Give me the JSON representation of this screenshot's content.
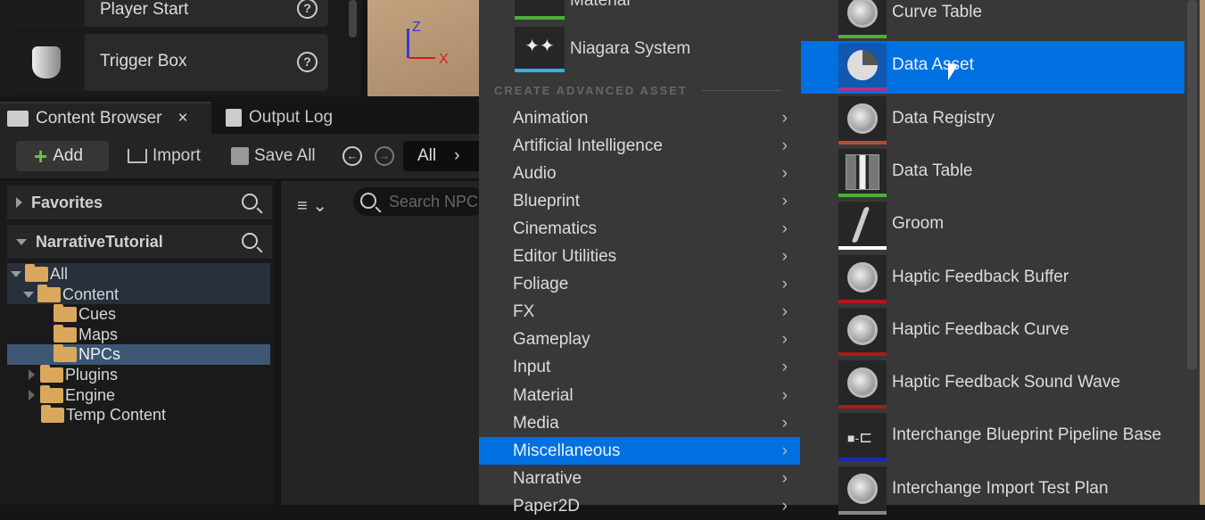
{
  "place_actors": [
    {
      "label": "Player Start"
    },
    {
      "label": "Trigger Box"
    }
  ],
  "viewport": {
    "axis_z": "Z",
    "axis_x": "X"
  },
  "tabs": [
    {
      "label": "Content Browser",
      "close": "×"
    },
    {
      "label": "Output Log"
    }
  ],
  "toolbar": {
    "add": "Add",
    "import": "Import",
    "save_all": "Save All",
    "path": "All"
  },
  "sources": {
    "favorites": "Favorites",
    "project": "NarrativeTutorial"
  },
  "tree": [
    {
      "label": "All"
    },
    {
      "label": "Content"
    },
    {
      "label": "Cues"
    },
    {
      "label": "Maps"
    },
    {
      "label": "NPCs"
    },
    {
      "label": "Plugins"
    },
    {
      "label": "Engine"
    },
    {
      "label": "Temp Content"
    }
  ],
  "search": {
    "placeholder": "Search NPCs"
  },
  "menu": {
    "basic": [
      {
        "label": "Material"
      },
      {
        "label": "Niagara System"
      }
    ],
    "section": "CREATE ADVANCED ASSET",
    "categories": [
      {
        "label": "Animation"
      },
      {
        "label": "Artificial Intelligence"
      },
      {
        "label": "Audio"
      },
      {
        "label": "Blueprint"
      },
      {
        "label": "Cinematics"
      },
      {
        "label": "Editor Utilities"
      },
      {
        "label": "Foliage"
      },
      {
        "label": "FX"
      },
      {
        "label": "Gameplay"
      },
      {
        "label": "Input"
      },
      {
        "label": "Material"
      },
      {
        "label": "Media"
      },
      {
        "label": "Miscellaneous",
        "selected": true
      },
      {
        "label": "Narrative"
      },
      {
        "label": "Paper2D"
      }
    ]
  },
  "submenu": [
    {
      "label": "Curve Table",
      "color": "#4caf3a",
      "icon": "orb"
    },
    {
      "label": "Data Asset",
      "color": "#b0308a",
      "icon": "pie",
      "selected": true
    },
    {
      "label": "Data Registry",
      "color": "#b05030",
      "icon": "orb"
    },
    {
      "label": "Data Table",
      "color": "#4caf3a",
      "icon": "bars"
    },
    {
      "label": "Groom",
      "color": "#ffffff",
      "icon": "hair"
    },
    {
      "label": "Haptic Feedback Buffer",
      "color": "#b01818",
      "icon": "orb"
    },
    {
      "label": "Haptic Feedback Curve",
      "color": "#b01818",
      "icon": "orb"
    },
    {
      "label": "Haptic Feedback Sound Wave",
      "color": "#b01818",
      "icon": "orb"
    },
    {
      "label": "Interchange Blueprint Pipeline Base",
      "color": "#1a2ab0",
      "icon": "graph"
    },
    {
      "label": "Interchange Import Test Plan",
      "color": "#888888",
      "icon": "orb"
    }
  ],
  "colors": {
    "accent": "#0070e0",
    "menu_bg": "#383838",
    "tree_selected": "#3d5674"
  }
}
